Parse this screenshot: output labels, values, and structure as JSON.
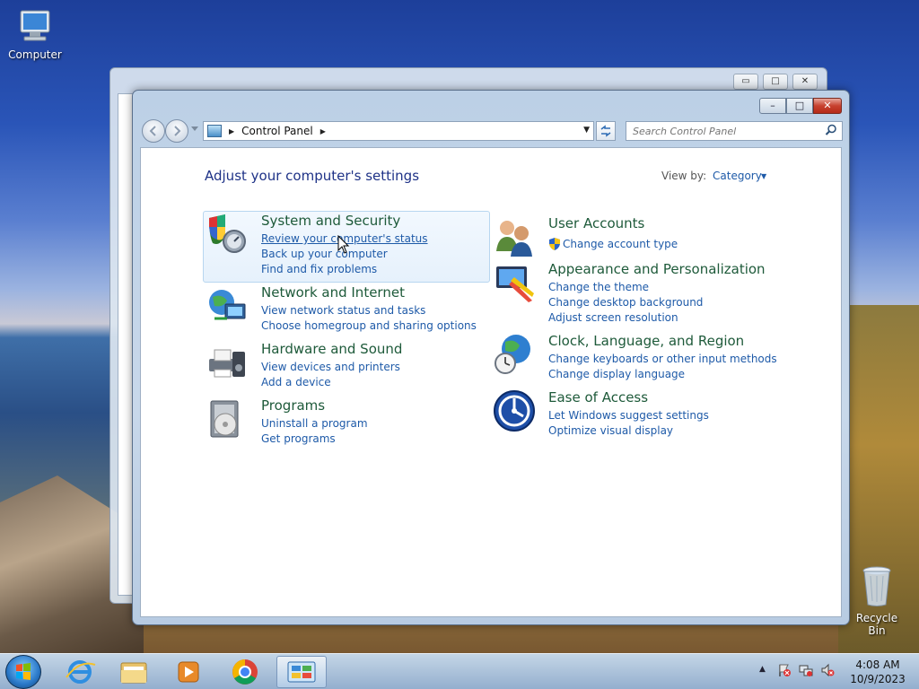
{
  "desktop": {
    "computer_label": "Computer",
    "recycle_label": "Recycle Bin"
  },
  "back_window": {
    "min": "▭",
    "max": "□",
    "close": "✕"
  },
  "window": {
    "min": "–",
    "max": "□",
    "close": "✕"
  },
  "address": {
    "breadcrumb": "Control Panel",
    "separator": "▶",
    "trail_arrow": "▶",
    "dropdown": "▼"
  },
  "search": {
    "placeholder": "Search Control Panel"
  },
  "content": {
    "heading": "Adjust your computer's settings",
    "view_by_label": "View by:",
    "view_by_value": "Category",
    "view_by_arrow": "▼"
  },
  "categories_left": [
    {
      "title": "System and Security",
      "links": [
        "Review your computer's status",
        "Back up your computer",
        "Find and fix problems"
      ]
    },
    {
      "title": "Network and Internet",
      "links": [
        "View network status and tasks",
        "Choose homegroup and sharing options"
      ]
    },
    {
      "title": "Hardware and Sound",
      "links": [
        "View devices and printers",
        "Add a device"
      ]
    },
    {
      "title": "Programs",
      "links": [
        "Uninstall a program",
        "Get programs"
      ]
    }
  ],
  "categories_right": [
    {
      "title": "User Accounts",
      "links": [
        "Change account type"
      ]
    },
    {
      "title": "Appearance and Personalization",
      "links": [
        "Change the theme",
        "Change desktop background",
        "Adjust screen resolution"
      ]
    },
    {
      "title": "Clock, Language, and Region",
      "links": [
        "Change keyboards or other input methods",
        "Change display language"
      ]
    },
    {
      "title": "Ease of Access",
      "links": [
        "Let Windows suggest settings",
        "Optimize visual display"
      ]
    }
  ],
  "taskbar": {
    "tray_arrow": "▲",
    "time": "4:08 AM",
    "date": "10/9/2023"
  }
}
